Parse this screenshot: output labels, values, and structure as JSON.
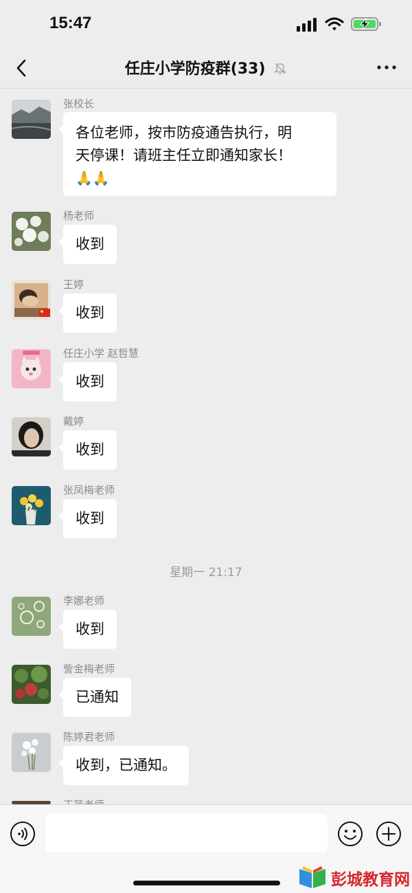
{
  "status_bar": {
    "time": "15:47"
  },
  "nav": {
    "title": "任庄小学防疫群(33)"
  },
  "messages": [
    {
      "sender": "张校长",
      "lines": [
        "各位老师，按市防疫通告执行，明",
        "天停课！请班主任立即通知家长！"
      ],
      "emoji": "🙏🙏"
    },
    {
      "sender": "杨老师",
      "text": "收到"
    },
    {
      "sender": "王婷",
      "text": "收到"
    },
    {
      "sender": "任庄小学 赵哲慧",
      "text": "收到"
    },
    {
      "sender": "戴婷",
      "text": "收到"
    },
    {
      "sender": "张凤梅老师",
      "text": "收到"
    },
    {
      "sender": "李娜老师",
      "text": "收到"
    },
    {
      "sender": "訾金梅老师",
      "text": "已通知"
    },
    {
      "sender": "陈婷君老师",
      "text": "收到，已通知。"
    },
    {
      "sender": "王萍老师"
    }
  ],
  "timestamp": "星期一 21:17",
  "watermark": {
    "text": "彭城教育网"
  },
  "colors": {
    "background": "#ededed",
    "bubble": "#ffffff",
    "watermark": "#d6262b"
  }
}
